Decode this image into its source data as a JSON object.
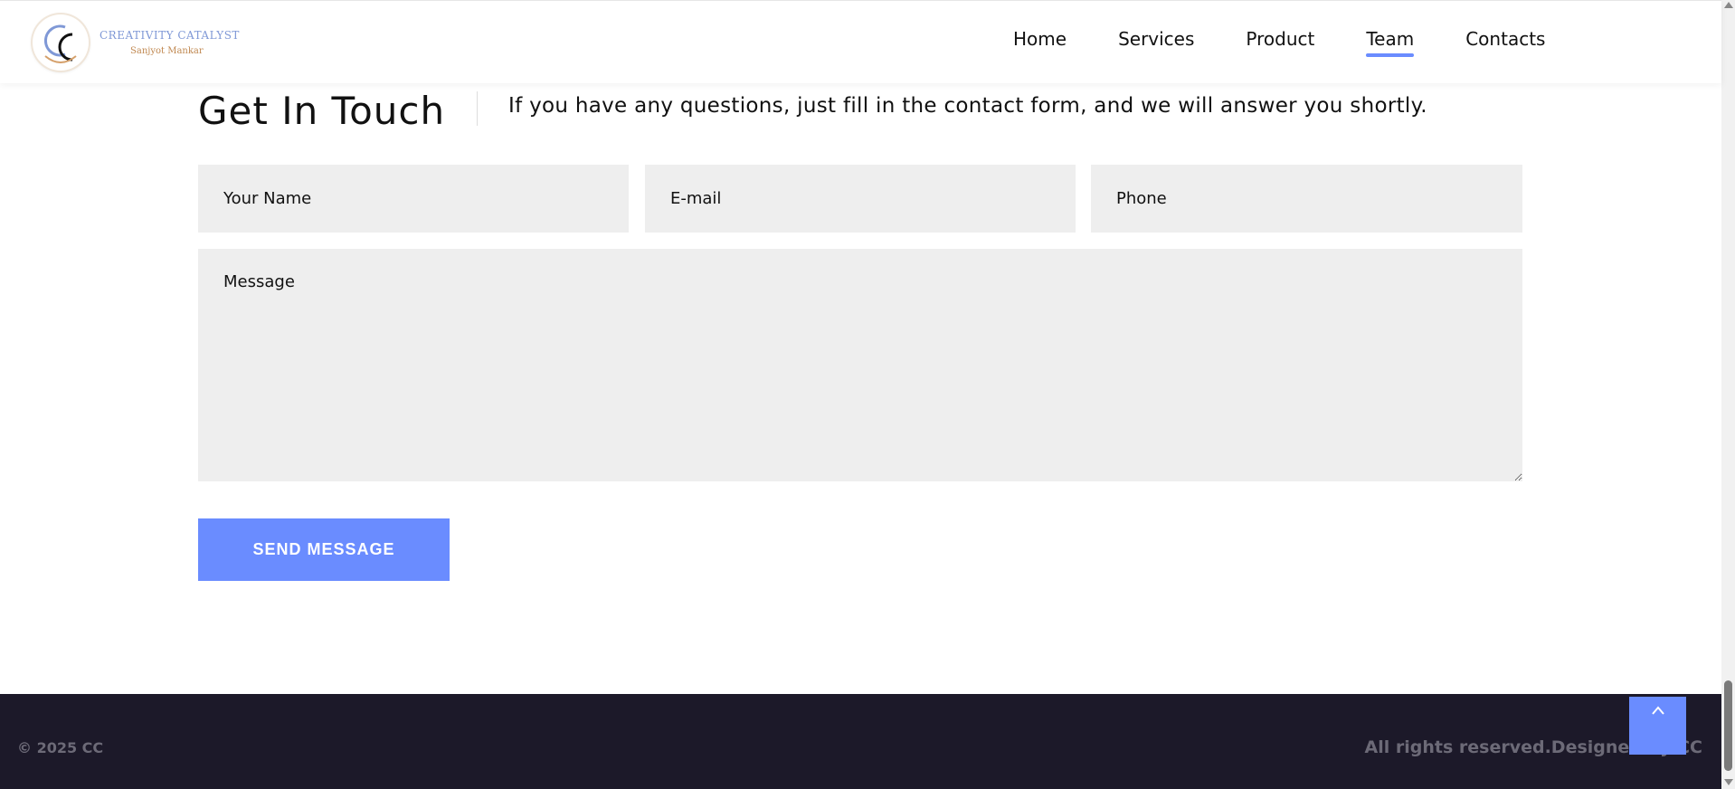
{
  "brand": {
    "name": "CREATIVITY CATALYST",
    "tagline": "Sanjyot Mankar",
    "colors": {
      "accent": "#6a8cff",
      "footer_bg": "#1c1929",
      "field_bg": "#eeeeee"
    }
  },
  "nav": {
    "items": [
      {
        "label": "Home",
        "active": false
      },
      {
        "label": "Services",
        "active": false
      },
      {
        "label": "Product",
        "active": false
      },
      {
        "label": "Team",
        "active": true
      },
      {
        "label": "Contacts",
        "active": false
      }
    ]
  },
  "contact": {
    "title": "Get In Touch",
    "subtitle": "If you have any questions, just fill in the contact form, and we will answer you shortly.",
    "fields": {
      "name_placeholder": "Your Name",
      "email_placeholder": "E-mail",
      "phone_placeholder": "Phone",
      "message_placeholder": "Message"
    },
    "submit_label": "SEND MESSAGE"
  },
  "footer": {
    "copyright": "© 2025 CC",
    "rights": "All rights reserved.Designed by CC"
  },
  "icons": {
    "back_to_top": "chevron-up-icon",
    "scroll_up": "arrow-up-icon",
    "scroll_down": "arrow-down-icon"
  }
}
